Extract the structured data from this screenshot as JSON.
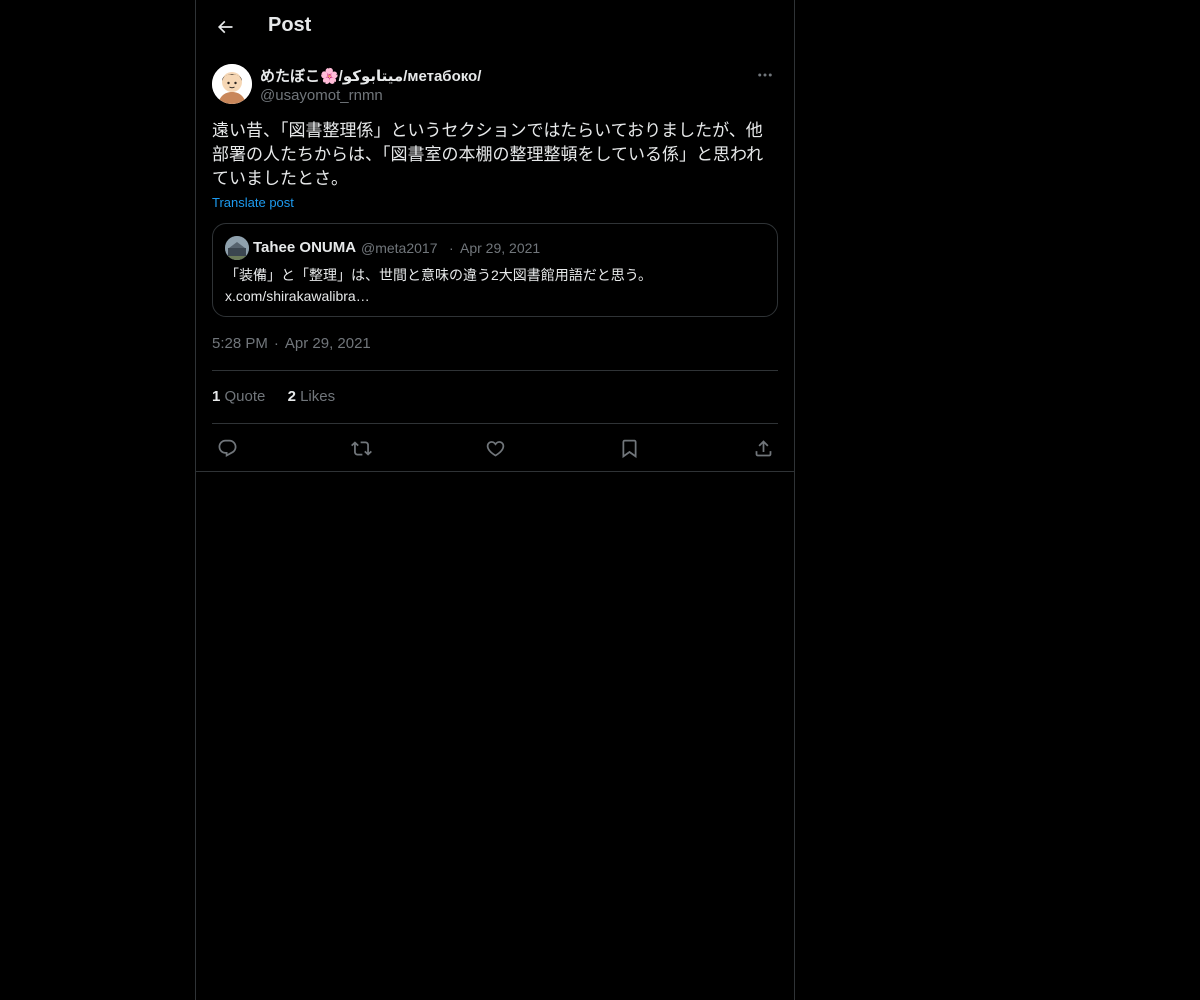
{
  "header": {
    "title": "Post",
    "back_icon": "arrow-left-icon"
  },
  "post": {
    "author_name": "めたぼこ🌸/میتابوکو/метабоко/",
    "author_handle": "@usayomot_rnmn",
    "text": "遠い昔、「図書整理係」というセクションではたらいておりましたが、他部署の人たちからは、「図書室の本棚の整理整頓をしている係」と思われていましたとさ。",
    "translate_label": "Translate post",
    "time": "5:28 PM",
    "date": "Apr 29, 2021",
    "separator": "·"
  },
  "quote": {
    "author_name": "Tahee ONUMA",
    "author_handle": "@meta2017",
    "separator": "·",
    "date": "Apr 29, 2021",
    "text_line1": "「装備」と「整理」は、世間と意味の違う2大図書館用語だと思う。",
    "text_line2": "x.com/shirakawalibra…"
  },
  "stats": {
    "quotes_count": "1",
    "quotes_label": "Quote",
    "likes_count": "2",
    "likes_label": "Likes"
  },
  "actions": [
    "reply-icon",
    "repost-icon",
    "like-icon",
    "bookmark-icon",
    "share-icon"
  ],
  "colors": {
    "background": "#000000",
    "text_primary": "#e7e9ea",
    "text_secondary": "#71767b",
    "link": "#1d9bf0",
    "border": "#2f3336"
  }
}
